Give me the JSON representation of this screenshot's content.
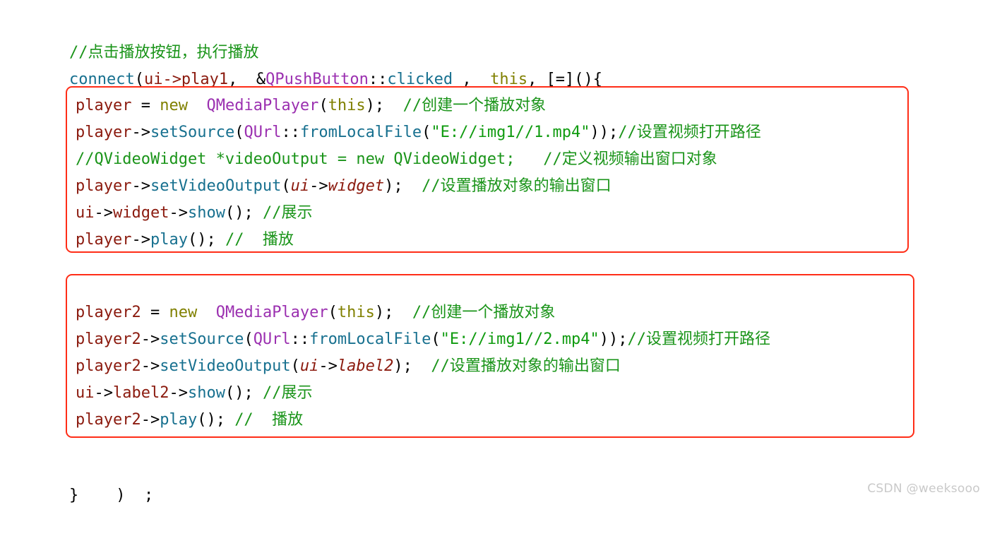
{
  "page": {
    "kind": "code-snippet-screenshot",
    "language": "C++ / Qt",
    "background_color": "#ffffff"
  },
  "colors": {
    "box_border": "#ff2d17",
    "comment": "#1a9419",
    "string": "#0f9b0f",
    "type": "#9b30b0",
    "function": "#17708f",
    "keyword": "#808000",
    "variable": "#8b1a0e",
    "plain": "#000000",
    "watermark": "#c9c9c9"
  },
  "header": {
    "line1": {
      "comment": "//点击播放按钮，执行播放"
    },
    "line2": {
      "func": "connect",
      "open_paren": "(",
      "var": "ui->play1",
      "comma1": ",  ",
      "amp": "&",
      "type": "QPushButton",
      "scope": "::",
      "member": "clicked",
      "comma2": " ,  ",
      "kw_this": "this",
      "tail": ", [=](){"
    }
  },
  "box1": {
    "lines": [
      {
        "id": "b1l1",
        "tokens": [
          {
            "t": "var",
            "v": "player"
          },
          {
            "t": "plain",
            "v": " = "
          },
          {
            "t": "kw",
            "v": "new"
          },
          {
            "t": "plain",
            "v": "  "
          },
          {
            "t": "type",
            "v": "QMediaPlayer"
          },
          {
            "t": "plain",
            "v": "("
          },
          {
            "t": "kw",
            "v": "this"
          },
          {
            "t": "plain",
            "v": ");  "
          },
          {
            "t": "comment",
            "v": "//创建一个播放对象"
          }
        ]
      },
      {
        "id": "b1l2",
        "tokens": [
          {
            "t": "var",
            "v": "player"
          },
          {
            "t": "plain",
            "v": "->"
          },
          {
            "t": "func",
            "v": "setSource"
          },
          {
            "t": "plain",
            "v": "("
          },
          {
            "t": "type",
            "v": "QUrl"
          },
          {
            "t": "plain",
            "v": "::"
          },
          {
            "t": "func",
            "v": "fromLocalFile"
          },
          {
            "t": "plain",
            "v": "("
          },
          {
            "t": "string",
            "v": "\"E://img1//1.mp4\""
          },
          {
            "t": "plain",
            "v": "));"
          },
          {
            "t": "comment",
            "v": "//设置视频打开路径"
          }
        ]
      },
      {
        "id": "b1l3",
        "tokens": [
          {
            "t": "comment",
            "v": "//QVideoWidget *videoOutput = new QVideoWidget;   //定义视频输出窗口对象"
          }
        ]
      },
      {
        "id": "b1l4",
        "tokens": [
          {
            "t": "var",
            "v": "player"
          },
          {
            "t": "plain",
            "v": "->"
          },
          {
            "t": "func",
            "v": "setVideoOutput"
          },
          {
            "t": "plain",
            "v": "("
          },
          {
            "t": "var-i",
            "v": "ui"
          },
          {
            "t": "plain",
            "v": "->"
          },
          {
            "t": "var-i",
            "v": "widget"
          },
          {
            "t": "plain",
            "v": ");  "
          },
          {
            "t": "comment",
            "v": "//设置播放对象的输出窗口"
          }
        ]
      },
      {
        "id": "b1l5",
        "tokens": [
          {
            "t": "var",
            "v": "ui"
          },
          {
            "t": "plain",
            "v": "->"
          },
          {
            "t": "var",
            "v": "widget"
          },
          {
            "t": "plain",
            "v": "->"
          },
          {
            "t": "func",
            "v": "show"
          },
          {
            "t": "plain",
            "v": "(); "
          },
          {
            "t": "comment",
            "v": "//展示"
          }
        ]
      },
      {
        "id": "b1l6",
        "tokens": [
          {
            "t": "var",
            "v": "player"
          },
          {
            "t": "plain",
            "v": "->"
          },
          {
            "t": "func",
            "v": "play"
          },
          {
            "t": "plain",
            "v": "(); "
          },
          {
            "t": "comment",
            "v": "//  播放"
          }
        ]
      }
    ]
  },
  "box2": {
    "lines": [
      {
        "id": "b2l1",
        "tokens": [
          {
            "t": "var",
            "v": "player2"
          },
          {
            "t": "plain",
            "v": " = "
          },
          {
            "t": "kw",
            "v": "new"
          },
          {
            "t": "plain",
            "v": "  "
          },
          {
            "t": "type",
            "v": "QMediaPlayer"
          },
          {
            "t": "plain",
            "v": "("
          },
          {
            "t": "kw",
            "v": "this"
          },
          {
            "t": "plain",
            "v": ");  "
          },
          {
            "t": "comment",
            "v": "//创建一个播放对象"
          }
        ]
      },
      {
        "id": "b2l2",
        "tokens": [
          {
            "t": "var",
            "v": "player2"
          },
          {
            "t": "plain",
            "v": "->"
          },
          {
            "t": "func",
            "v": "setSource"
          },
          {
            "t": "plain",
            "v": "("
          },
          {
            "t": "type",
            "v": "QUrl"
          },
          {
            "t": "plain",
            "v": "::"
          },
          {
            "t": "func",
            "v": "fromLocalFile"
          },
          {
            "t": "plain",
            "v": "("
          },
          {
            "t": "string",
            "v": "\"E://img1//2.mp4\""
          },
          {
            "t": "plain",
            "v": "));"
          },
          {
            "t": "comment",
            "v": "//设置视频打开路径"
          }
        ]
      },
      {
        "id": "b2l3",
        "tokens": [
          {
            "t": "var",
            "v": "player2"
          },
          {
            "t": "plain",
            "v": "->"
          },
          {
            "t": "func",
            "v": "setVideoOutput"
          },
          {
            "t": "plain",
            "v": "("
          },
          {
            "t": "var-i",
            "v": "ui"
          },
          {
            "t": "plain",
            "v": "->"
          },
          {
            "t": "var-i",
            "v": "label2"
          },
          {
            "t": "plain",
            "v": ");  "
          },
          {
            "t": "comment",
            "v": "//设置播放对象的输出窗口"
          }
        ]
      },
      {
        "id": "b2l4",
        "tokens": [
          {
            "t": "var",
            "v": "ui"
          },
          {
            "t": "plain",
            "v": "->"
          },
          {
            "t": "var",
            "v": "label2"
          },
          {
            "t": "plain",
            "v": "->"
          },
          {
            "t": "func",
            "v": "show"
          },
          {
            "t": "plain",
            "v": "(); "
          },
          {
            "t": "comment",
            "v": "//展示"
          }
        ]
      },
      {
        "id": "b2l5",
        "tokens": [
          {
            "t": "var",
            "v": "player2"
          },
          {
            "t": "plain",
            "v": "->"
          },
          {
            "t": "func",
            "v": "play"
          },
          {
            "t": "plain",
            "v": "(); "
          },
          {
            "t": "comment",
            "v": "//  播放"
          }
        ]
      }
    ]
  },
  "footer": {
    "closing": "}    )  ;"
  },
  "watermark": {
    "text": "CSDN @weeksooo"
  }
}
